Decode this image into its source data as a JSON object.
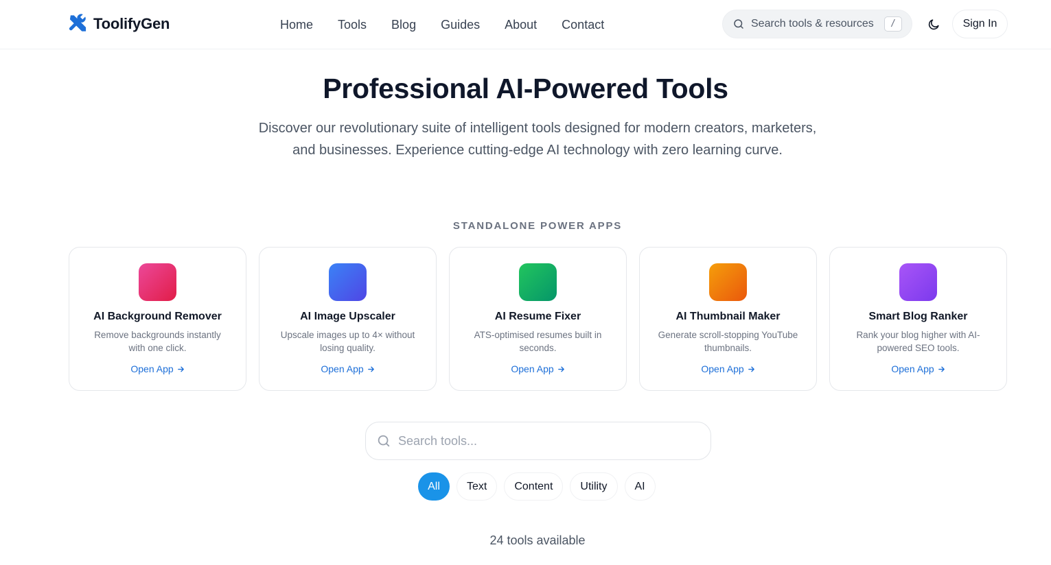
{
  "brand": {
    "name": "ToolifyGen",
    "accent": "#1d6fd8"
  },
  "nav": {
    "items": [
      "Home",
      "Tools",
      "Blog",
      "Guides",
      "About",
      "Contact"
    ]
  },
  "header_search": {
    "placeholder": "Search tools & resources",
    "shortcut": "/"
  },
  "header_actions": {
    "theme_icon": "moon-icon",
    "sign_in": "Sign In"
  },
  "hero": {
    "title": "Professional AI-Powered Tools",
    "subtitle": "Discover our revolutionary suite of intelligent tools designed for modern creators, marketers, and businesses. Experience cutting-edge AI technology with zero learning curve."
  },
  "apps_section": {
    "label": "STANDALONE POWER APPS",
    "apps": [
      {
        "name": "AI Background Remover",
        "description": "Remove backgrounds instantly with one click.",
        "link": "Open App",
        "color_from": "#ec4899",
        "color_to": "#e11d48"
      },
      {
        "name": "AI Image Upscaler",
        "description": "Upscale images up to 4× without losing quality.",
        "link": "Open App",
        "color_from": "#3b82f6",
        "color_to": "#4f46e5"
      },
      {
        "name": "AI Resume Fixer",
        "description": "ATS-optimised resumes built in seconds.",
        "link": "Open App",
        "color_from": "#22c55e",
        "color_to": "#059669"
      },
      {
        "name": "AI Thumbnail Maker",
        "description": "Generate scroll-stopping YouTube thumbnails.",
        "link": "Open App",
        "color_from": "#f59e0b",
        "color_to": "#ea580c"
      },
      {
        "name": "Smart Blog Ranker",
        "description": "Rank your blog higher with AI-powered SEO tools.",
        "link": "Open App",
        "color_from": "#a855f7",
        "color_to": "#7c3aed"
      }
    ]
  },
  "tool_search": {
    "placeholder": "Search tools..."
  },
  "filters": {
    "items": [
      "All",
      "Text",
      "Content",
      "Utility",
      "AI"
    ],
    "active": "All",
    "active_color": "#1a93e8"
  },
  "tools_count": "24 tools available"
}
